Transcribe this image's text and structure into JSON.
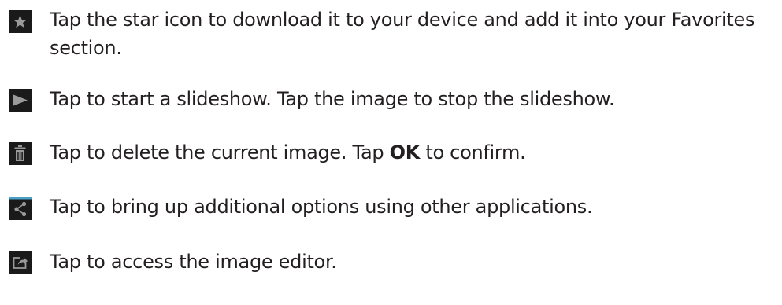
{
  "instructions": [
    {
      "icon": "star-icon",
      "text": "Tap the star icon to download it to your device and add it into your Favorites section."
    },
    {
      "icon": "play-icon",
      "text": "Tap to start a slideshow. Tap the image to stop the slideshow."
    },
    {
      "icon": "trash-icon",
      "text_before": "Tap to delete the current image. Tap ",
      "text_bold": "OK",
      "text_after": " to confirm."
    },
    {
      "icon": "share-icon",
      "text": "Tap to bring up additional options using other applications."
    },
    {
      "icon": "edit-icon",
      "text": "Tap to access the image editor."
    }
  ],
  "colors": {
    "text": "#231f20",
    "icon_background": "#1a1a1a",
    "icon_glyph": "#9a9a9a",
    "share_accent": "#4a9fc4"
  }
}
